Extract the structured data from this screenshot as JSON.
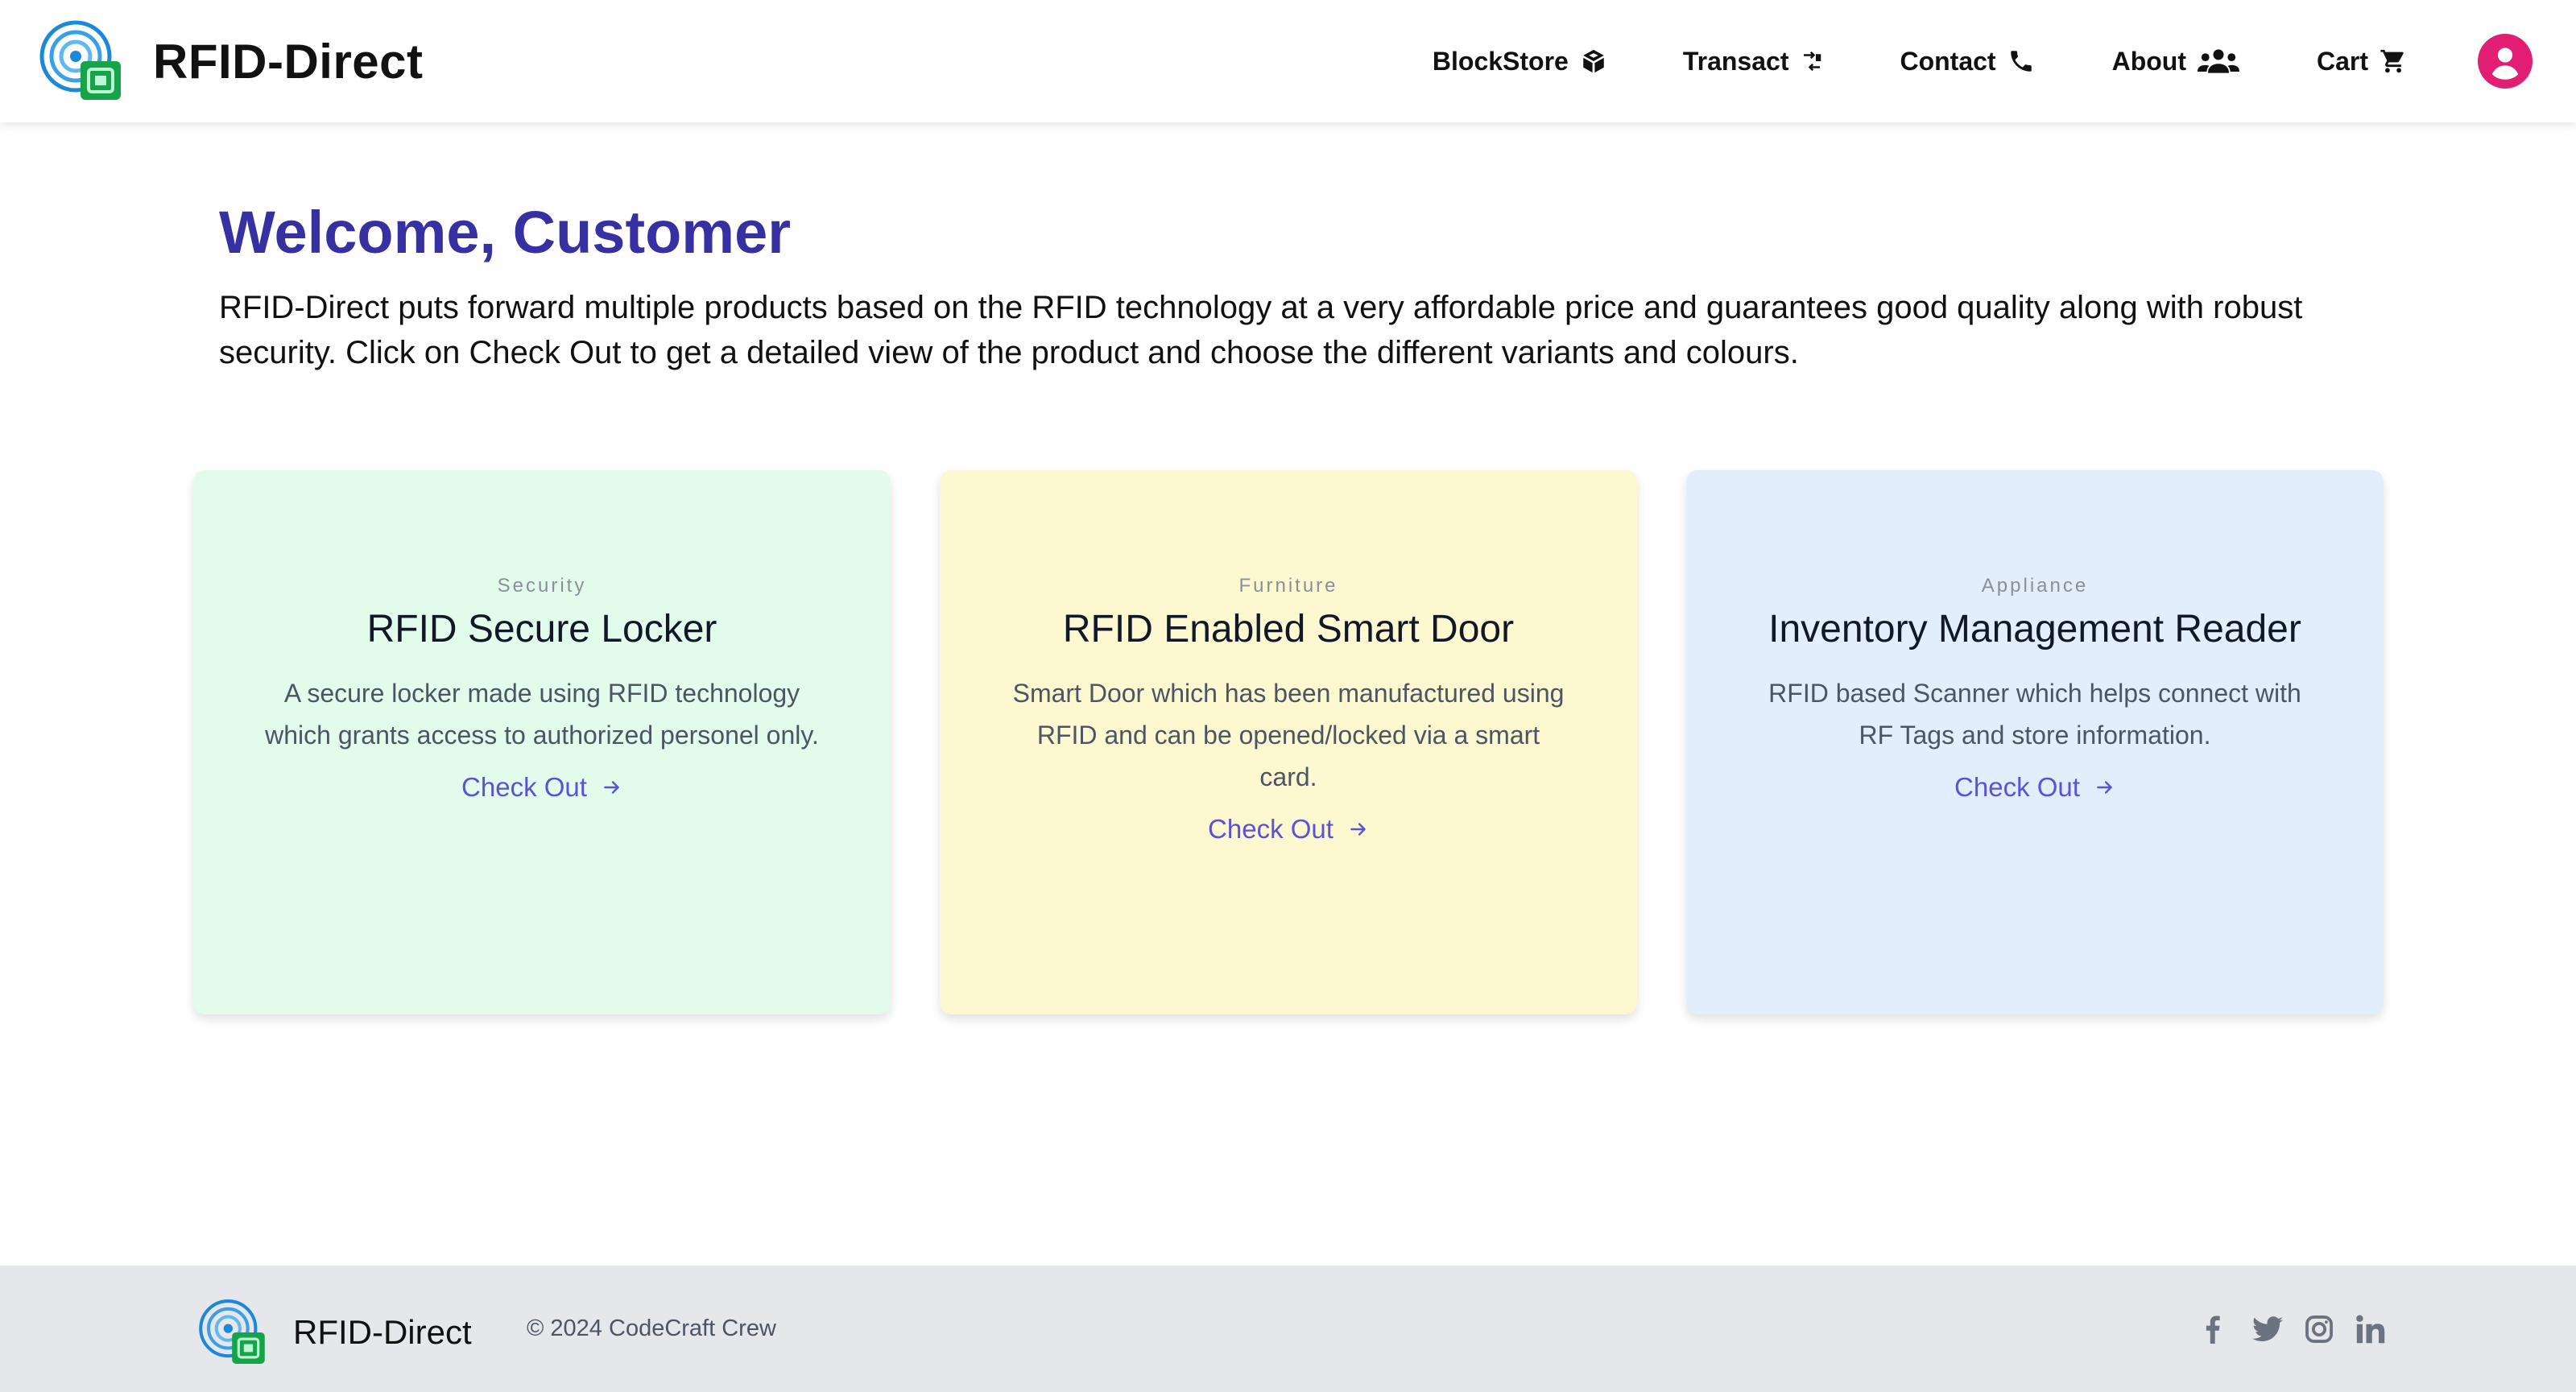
{
  "header": {
    "brand_name": "RFID-Direct",
    "nav": [
      {
        "label": "BlockStore",
        "icon": "blockstore-cube-icon"
      },
      {
        "label": "Transact",
        "icon": "transaction-icon"
      },
      {
        "label": "Contact",
        "icon": "phone-icon"
      },
      {
        "label": "About",
        "icon": "people-icon"
      },
      {
        "label": "Cart",
        "icon": "cart-icon"
      }
    ],
    "avatar_icon": "user-avatar-icon",
    "avatar_color": "#e11d74"
  },
  "main": {
    "welcome_title": "Welcome, Customer",
    "intro": "RFID-Direct puts forward multiple products based on the RFID technology at a very affordable price and guarantees good quality along with robust security. Click on Check Out to get a detailed view of the product and choose the different variants and colours.",
    "cards": [
      {
        "category": "Security",
        "title": "RFID Secure Locker",
        "description": "A secure locker made using RFID technology which grants access to authorized personel only.",
        "link_label": "Check Out",
        "bg_color": "#e3fbeb"
      },
      {
        "category": "Furniture",
        "title": "RFID Enabled Smart Door",
        "description": "Smart Door which has been manufactured using RFID and can be opened/locked via a smart card.",
        "link_label": "Check Out",
        "bg_color": "#fdf8d0"
      },
      {
        "category": "Appliance",
        "title": "Inventory Management Reader",
        "description": "RFID based Scanner which helps connect with RF Tags and store information.",
        "link_label": "Check Out",
        "bg_color": "#e3eefd"
      }
    ],
    "accent_color": "#3730a3",
    "link_color": "#5b52d6"
  },
  "footer": {
    "brand_name": "RFID-Direct",
    "copyright": "© 2024 CodeCraft Crew",
    "socials": [
      "facebook-icon",
      "twitter-icon",
      "instagram-icon",
      "linkedin-icon"
    ],
    "bg_color": "#e5e7eb"
  }
}
